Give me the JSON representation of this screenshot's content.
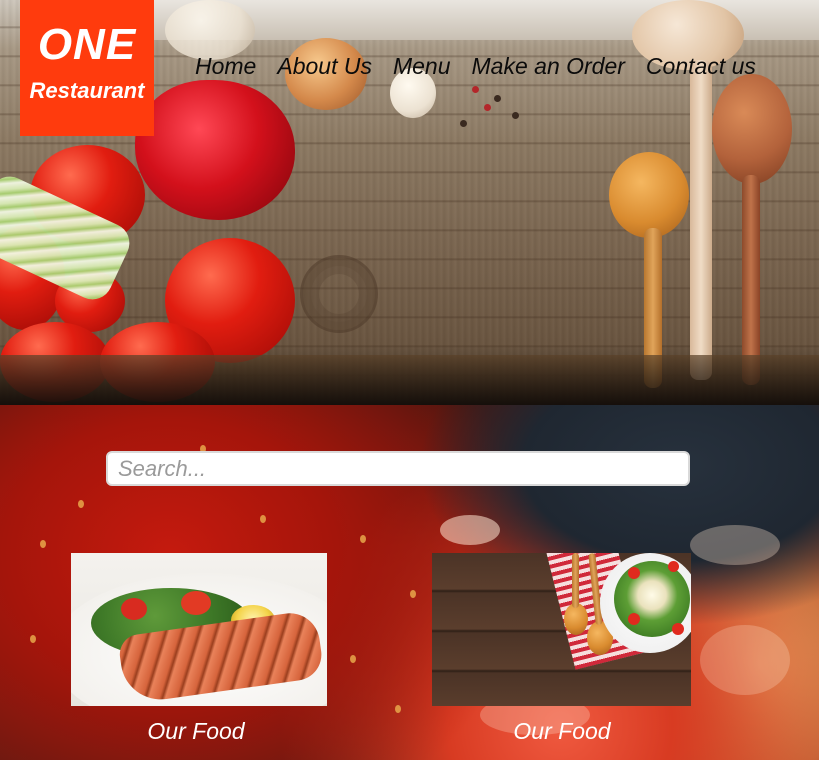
{
  "logo": {
    "line1": "ONE",
    "line2": "Restaurant",
    "bg_color": "#ff3b0d"
  },
  "nav": {
    "items": [
      {
        "label": "Home"
      },
      {
        "label": "About Us"
      },
      {
        "label": "Menu"
      },
      {
        "label": "Make an Order"
      },
      {
        "label": "Contact us"
      }
    ]
  },
  "search": {
    "placeholder": "Search...",
    "value": ""
  },
  "cards": [
    {
      "caption": "Our Food",
      "image": "grilled-salmon-salad-photo"
    },
    {
      "caption": "Our Food",
      "image": "salad-bowl-wooden-table-photo"
    }
  ]
}
